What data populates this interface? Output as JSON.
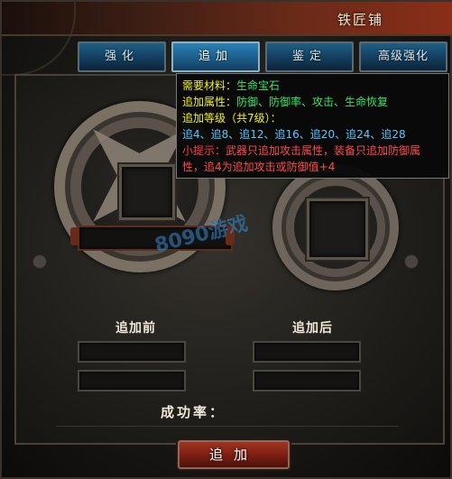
{
  "window": {
    "title": "铁匠铺",
    "close_label": "✕"
  },
  "tabs": [
    {
      "label": "强化",
      "active": false
    },
    {
      "label": "追加",
      "active": true
    },
    {
      "label": "鉴定",
      "active": false
    },
    {
      "label": "高级强化",
      "active": false
    }
  ],
  "tooltip": {
    "line1_key": "需要材料：",
    "line1_val": "生命宝石",
    "line2_key": "追加属性：",
    "line2_val": "防御、防御率、攻击、生命恢复",
    "line3_key": "追加等级",
    "line3_val": "（共7级）：",
    "levels": "追4、追8、追12、追16、追20、追24、追28",
    "hint_key": "小提示：",
    "hint_val_1": "武器只追加攻击属性，装备只追加防御属",
    "hint_val_2": "性，追4为追加攻击或防御值+4"
  },
  "labels": {
    "before": "追加前",
    "after": "追加后",
    "success_rate": "成功率："
  },
  "action": {
    "button_label": "追加"
  },
  "watermark": "8090游戏",
  "colors": {
    "tab_active": "#1a5a86",
    "button_red": "#7a1e12",
    "tooltip_yellow": "#f2f21c",
    "tooltip_green": "#39e46a",
    "tooltip_blue": "#58c8ff",
    "tooltip_red": "#ff4a4a"
  }
}
